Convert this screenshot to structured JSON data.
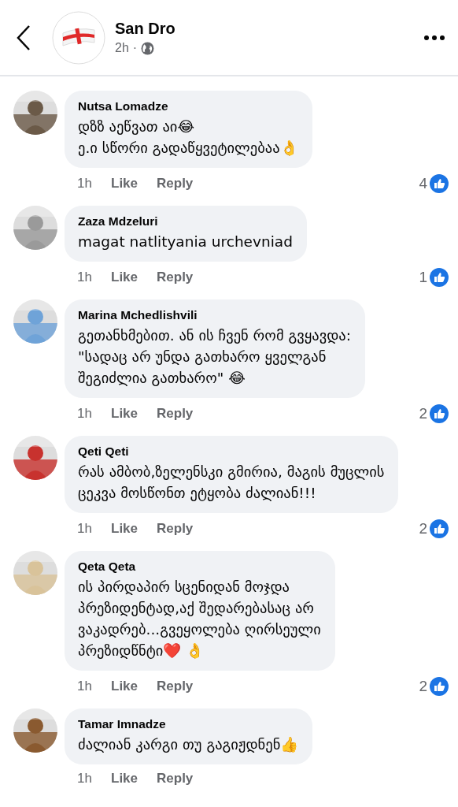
{
  "header": {
    "title": "San Dro",
    "time": "2h",
    "separator": "·"
  },
  "comments": [
    {
      "author": "Nutsa Lomadze",
      "text": "დზზ აეწვათ აი😂\nე.ი სწორი გადაწყვეტილებაა👌",
      "time": "1h",
      "like": "Like",
      "reply": "Reply",
      "reactions": "4"
    },
    {
      "author": "Zaza Mdzeluri",
      "text": "magat natlityania urchevniad",
      "time": "1h",
      "like": "Like",
      "reply": "Reply",
      "reactions": "1"
    },
    {
      "author": "Marina Mchedlishvili",
      "text": "გეთანხმებით. ან ის ჩვენ რომ გვყავდა:\n\"სადაც არ უნდა გათხარო ყველგან\nშეგიძლია გათხარო\" 😂",
      "time": "1h",
      "like": "Like",
      "reply": "Reply",
      "reactions": "2"
    },
    {
      "author": "Qeti Qeti",
      "text": "რას ამბობ,ზელენსკი გმირია, მაგის მუცლის\nცეკვა მოსწონთ ეტყობა ძალიან!!!",
      "time": "1h",
      "like": "Like",
      "reply": "Reply",
      "reactions": "2"
    },
    {
      "author": "Qeta Qeta",
      "text": "ის პირდაპირ სცენიდან მოჯდა\nპრეზიდენტად,აქ შედარებასაც არ\nვაკადრებ...გვეყოლება ღირსეული\nპრეზიდწნტი❤️ 👌",
      "time": "1h",
      "like": "Like",
      "reply": "Reply",
      "reactions": "2"
    },
    {
      "author": "Tamar Imnadze",
      "text": "ძალიან კარგი თუ გაგიჟდნენ👍",
      "time": "1h",
      "like": "Like",
      "reply": "Reply"
    }
  ]
}
